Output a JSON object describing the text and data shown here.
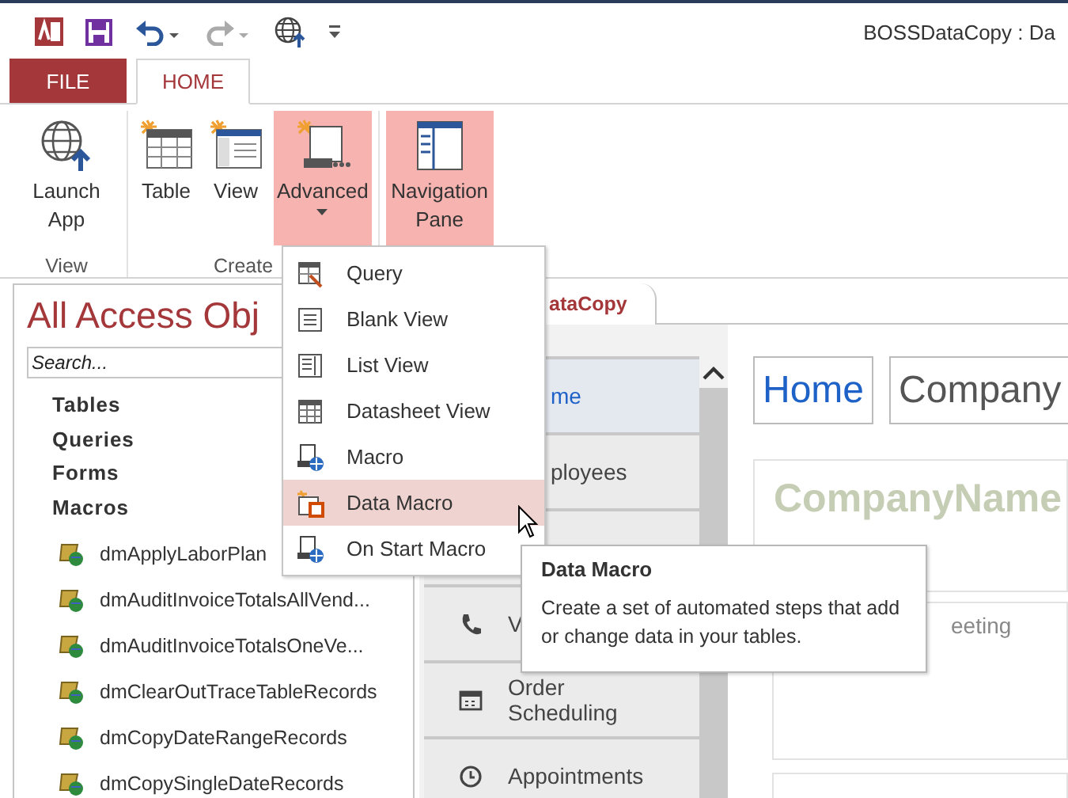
{
  "window": {
    "title": "BOSSDataCopy : Da"
  },
  "ribbon_tabs": [
    {
      "label": "FILE",
      "kind": "file",
      "selected": false
    },
    {
      "label": "HOME",
      "kind": "tab",
      "selected": true
    }
  ],
  "ribbon_groups": [
    {
      "label": "View",
      "buttons": [
        {
          "label": "Launch App",
          "kind": "globe",
          "highlighted": false,
          "dropdown": false
        }
      ]
    },
    {
      "label": "Create",
      "buttons": [
        {
          "label": "Table",
          "kind": "table",
          "highlighted": false,
          "dropdown": false
        },
        {
          "label": "View",
          "kind": "view",
          "highlighted": false,
          "dropdown": false
        },
        {
          "label": "Advanced",
          "kind": "macro",
          "highlighted": true,
          "dropdown": true
        }
      ]
    },
    {
      "buttons": [
        {
          "label": "Navigation Pane",
          "kind": "navpane",
          "highlighted": true,
          "dropdown": false
        }
      ]
    }
  ],
  "nav_pane": {
    "title": "All Access Obj",
    "search": {
      "placeholder": "Search..."
    },
    "categories": [
      "Tables",
      "Queries",
      "Forms",
      "Macros"
    ],
    "macros": [
      "dmApplyLaborPlan",
      "dmAuditInvoiceTotalsAllVend...",
      "dmAuditInvoiceTotalsOneVe...",
      "dmClearOutTraceTableRecords",
      "dmCopyDateRangeRecords",
      "dmCopySingleDateRecords"
    ]
  },
  "document_tab": {
    "label": "ataCopy"
  },
  "form_nav": {
    "items": [
      {
        "label": "me",
        "kind": "partial",
        "selected": true
      },
      {
        "label": "ployees",
        "kind": "partial",
        "selected": false
      },
      {
        "kind": "covered"
      },
      {
        "label": "V",
        "kind": "phone",
        "selected": false
      },
      {
        "label": "Order Scheduling",
        "kind": "calendar",
        "selected": false
      },
      {
        "label": "Appointments",
        "kind": "clock",
        "selected": false
      }
    ]
  },
  "form": {
    "header_boxes": [
      {
        "label": "Home",
        "kind": "link"
      },
      {
        "label": "Company",
        "kind": "title"
      }
    ],
    "company_name": "CompanyName",
    "meeting_text": "eeting"
  },
  "dropdown_menu": {
    "items": [
      {
        "label": "Query",
        "kind": "query",
        "selected": false
      },
      {
        "label": "Blank View",
        "kind": "blank",
        "selected": false
      },
      {
        "label": "List View",
        "kind": "list",
        "selected": false
      },
      {
        "label": "Datasheet View",
        "kind": "datasheet",
        "selected": false
      },
      {
        "label": "Macro",
        "kind": "macro",
        "selected": false
      },
      {
        "label": "Data Macro",
        "kind": "datamacro",
        "selected": true
      },
      {
        "label": "On Start Macro",
        "kind": "macro",
        "selected": false
      }
    ]
  },
  "tooltip": {
    "title": "Data Macro",
    "text": "Create a set of automated steps that add or change data in your tables."
  }
}
